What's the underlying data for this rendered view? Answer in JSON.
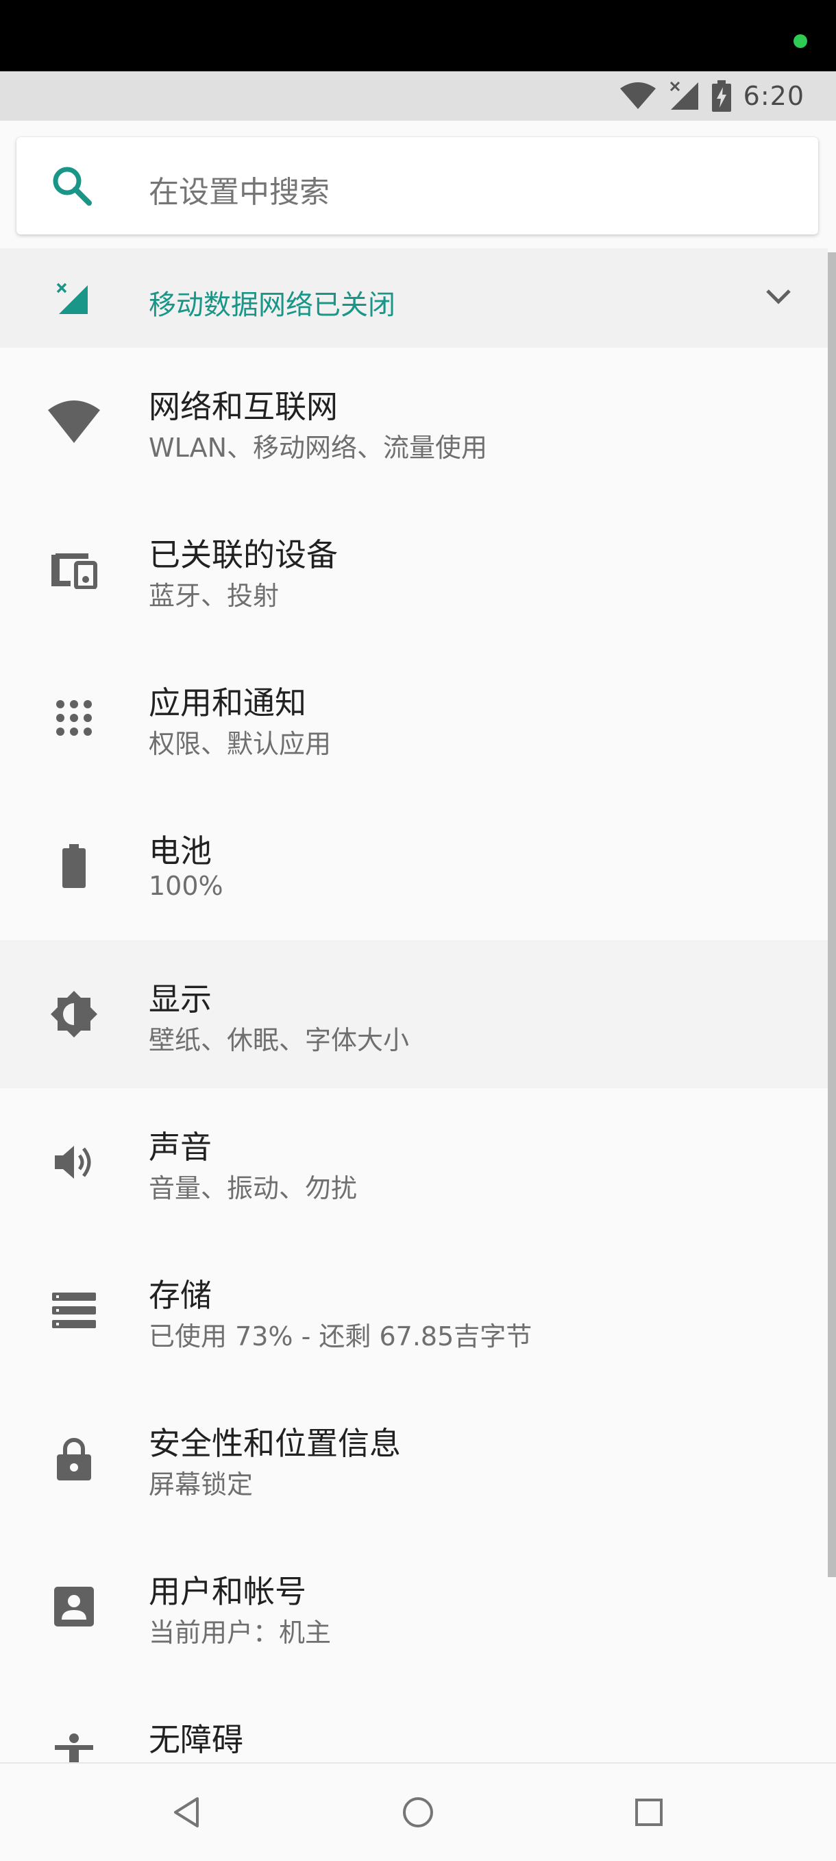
{
  "status_bar": {
    "time": "6:20"
  },
  "search": {
    "placeholder": "在设置中搜索"
  },
  "suggestion": {
    "label": "移动数据网络已关闭"
  },
  "settings": [
    {
      "title": "网络和互联网",
      "subtitle": "WLAN、移动网络、流量使用",
      "icon": "wifi-icon"
    },
    {
      "title": "已关联的设备",
      "subtitle": "蓝牙、投射",
      "icon": "connected-devices-icon"
    },
    {
      "title": "应用和通知",
      "subtitle": "权限、默认应用",
      "icon": "apps-grid-icon"
    },
    {
      "title": "电池",
      "subtitle": "100%",
      "icon": "battery-icon"
    },
    {
      "title": "显示",
      "subtitle": "壁纸、休眠、字体大小",
      "icon": "brightness-icon"
    },
    {
      "title": "声音",
      "subtitle": "音量、振动、勿扰",
      "icon": "volume-icon"
    },
    {
      "title": "存储",
      "subtitle": "已使用 73% - 还剩 67.85吉字节",
      "icon": "storage-icon"
    },
    {
      "title": "安全性和位置信息",
      "subtitle": "屏幕锁定",
      "icon": "lock-icon"
    },
    {
      "title": "用户和帐号",
      "subtitle": "当前用户：机主",
      "icon": "account-icon"
    },
    {
      "title": "无障碍",
      "subtitle": "",
      "icon": "accessibility-icon"
    }
  ],
  "colors": {
    "accent": "#1a9688",
    "icon_gray": "#616161"
  }
}
